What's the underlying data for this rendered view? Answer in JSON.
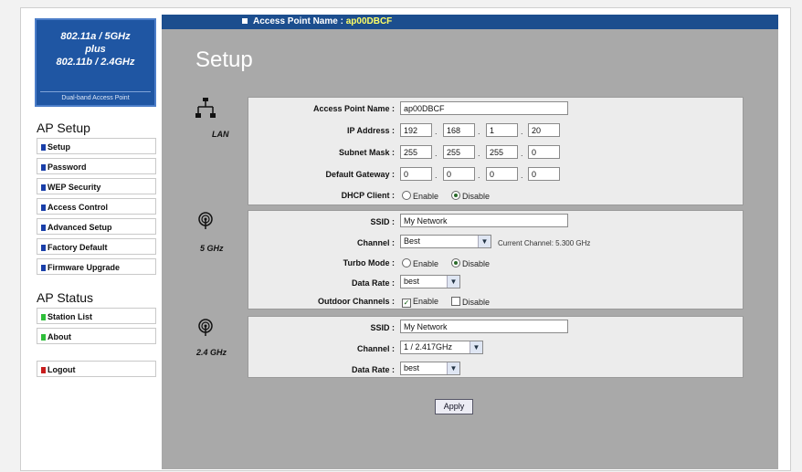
{
  "header": {
    "label": "Access Point Name :",
    "ap_name": "ap00DBCF"
  },
  "brand": {
    "line1": "802.11a / 5GHz",
    "line2": "plus",
    "line3": "802.11b / 2.4GHz",
    "tagline": "Dual-band Access Point"
  },
  "sidebar": {
    "ap_setup_title": "AP Setup",
    "setup_items": [
      "Setup",
      "Password",
      "WEP Security",
      "Access Control",
      "Advanced Setup",
      "Factory Default",
      "Firmware Upgrade"
    ],
    "ap_status_title": "AP Status",
    "status_items": [
      "Station List",
      "About"
    ],
    "logout": "Logout"
  },
  "colors": {
    "setup_dot": "#1a3fa8",
    "status_dot": "#2fbf3a",
    "logout_dot": "#c81e1e"
  },
  "page_title": "Setup",
  "lan": {
    "band_label": "LAN",
    "ap_name_label": "Access Point Name :",
    "ap_name_value": "ap00DBCF",
    "ip_label": "IP Address :",
    "ip": [
      "192",
      "168",
      "1",
      "20"
    ],
    "mask_label": "Subnet Mask :",
    "mask": [
      "255",
      "255",
      "255",
      "0"
    ],
    "gateway_label": "Default Gateway :",
    "gateway": [
      "0",
      "0",
      "0",
      "0"
    ],
    "dhcp_label": "DHCP Client :",
    "enable": "Enable",
    "disable": "Disable"
  },
  "ghz5": {
    "band_label": "5 GHz",
    "ssid_label": "SSID :",
    "ssid": "My Network",
    "channel_label": "Channel :",
    "channel": "Best",
    "current_channel": "Current Channel: 5.300 GHz",
    "turbo_label": "Turbo Mode :",
    "enable": "Enable",
    "disable": "Disable",
    "rate_label": "Data Rate :",
    "rate": "best",
    "outdoor_label": "Outdoor Channels :"
  },
  "ghz24": {
    "band_label": "2.4 GHz",
    "ssid_label": "SSID :",
    "ssid": "My Network",
    "channel_label": "Channel :",
    "channel": "1 / 2.417GHz",
    "rate_label": "Data Rate :",
    "rate": "best"
  },
  "apply_label": "Apply"
}
